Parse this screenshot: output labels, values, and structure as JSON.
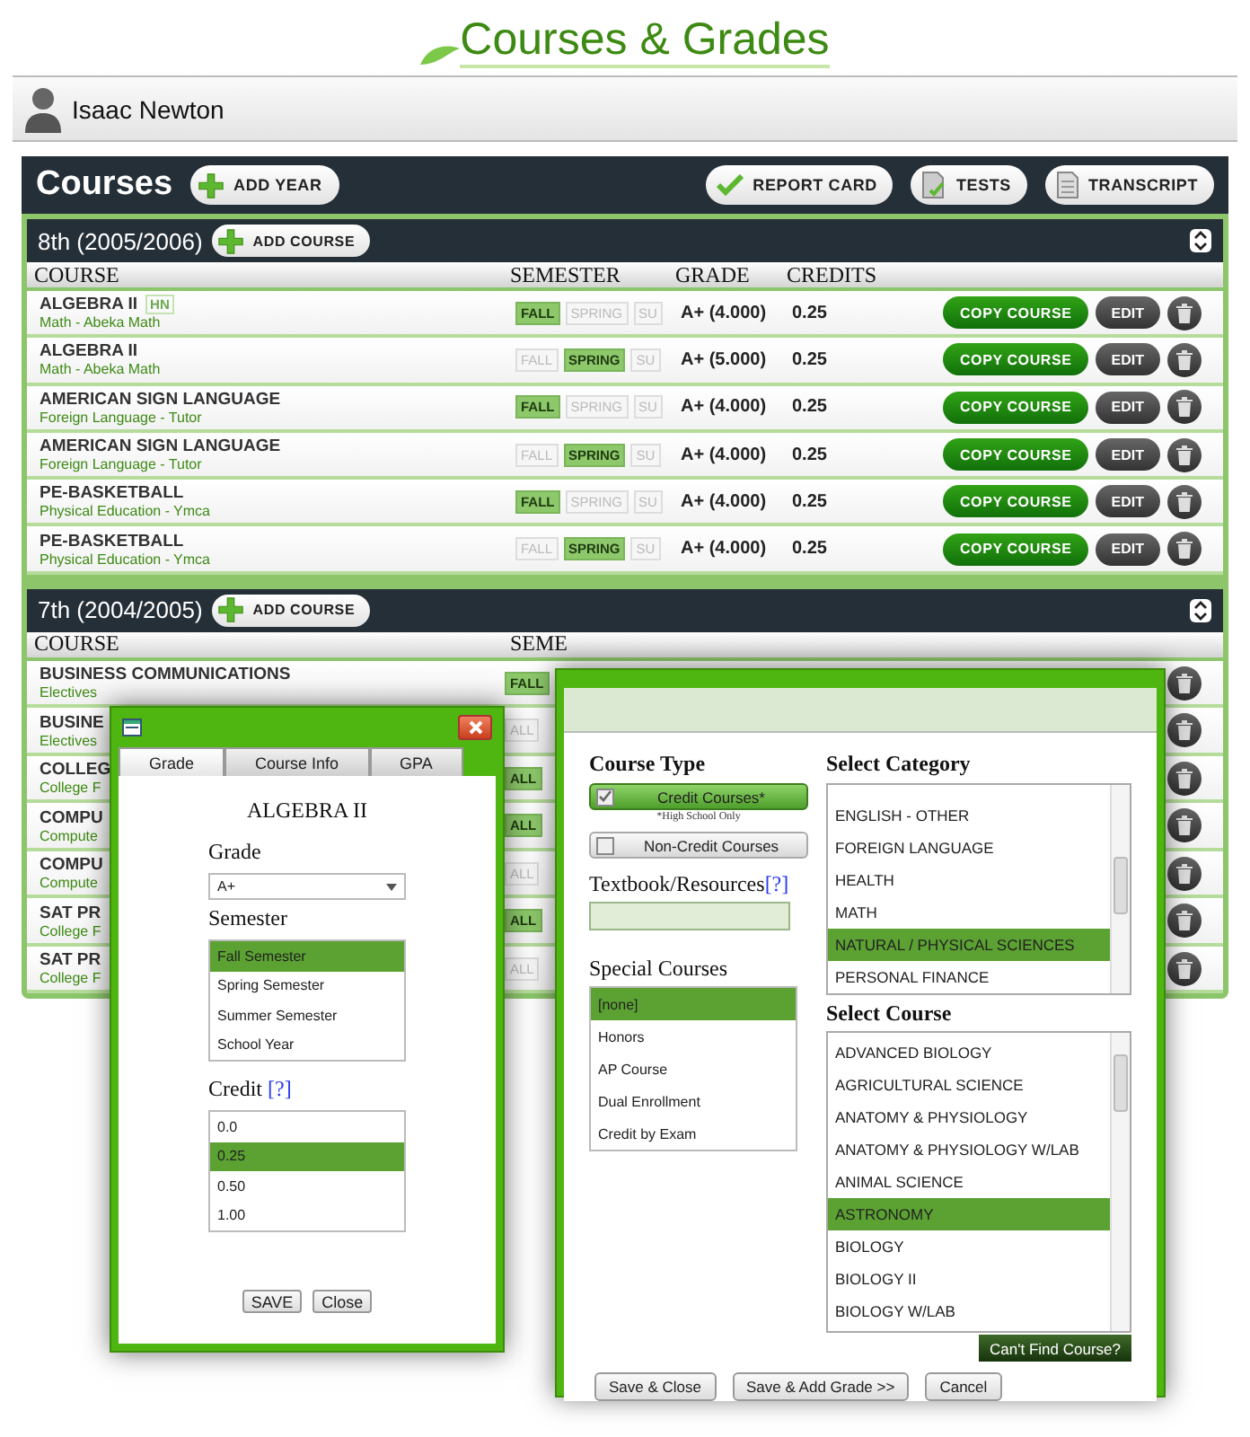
{
  "page_title": "Courses & Grades",
  "user": {
    "name": "Isaac Newton"
  },
  "courses_bar": {
    "title": "Courses",
    "add_button": "ADD YEAR",
    "actions": [
      {
        "label": "REPORT CARD",
        "kind": "check"
      },
      {
        "label": "TESTS",
        "kind": "tests"
      },
      {
        "label": "TRANSCRIPT",
        "kind": "doc"
      }
    ]
  },
  "year": {
    "title": "8th (2005/2006)",
    "add_button": "ADD COURSE",
    "columns": [
      "COURSE",
      "SEMESTER",
      "GRADE",
      "CREDITS"
    ],
    "rows": [
      {
        "name": "ALGEBRA II",
        "badge": "HN",
        "subtitle": "Math - Abeka Math",
        "semesters": [
          {
            "label": "FALL",
            "selected": true
          },
          {
            "label": "SPRING",
            "selected": false
          },
          {
            "label": "SU",
            "selected": false
          }
        ],
        "grade": "A+ (4.000)",
        "credits": "0.25",
        "copy_button": "COPY COURSE",
        "edit_button": "EDIT"
      },
      {
        "name": "ALGEBRA II",
        "subtitle": "Math - Abeka Math",
        "semesters": [
          {
            "label": "FALL",
            "selected": false
          },
          {
            "label": "SPRING",
            "selected": true
          },
          {
            "label": "SU",
            "selected": false
          }
        ],
        "grade": "A+ (5.000)",
        "credits": "0.25",
        "copy_button": "COPY COURSE",
        "edit_button": "EDIT"
      },
      {
        "name": "AMERICAN SIGN LANGUAGE",
        "subtitle": "Foreign Language - Tutor",
        "semesters": [
          {
            "label": "FALL",
            "selected": true
          },
          {
            "label": "SPRING",
            "selected": false
          },
          {
            "label": "SU",
            "selected": false
          }
        ],
        "grade": "A+ (4.000)",
        "credits": "0.25",
        "copy_button": "COPY COURSE",
        "edit_button": "EDIT"
      },
      {
        "name": "AMERICAN SIGN LANGUAGE",
        "subtitle": "Foreign Language - Tutor",
        "semesters": [
          {
            "label": "FALL",
            "selected": false
          },
          {
            "label": "SPRING",
            "selected": true
          },
          {
            "label": "SU",
            "selected": false
          }
        ],
        "grade": "A+ (4.000)",
        "credits": "0.25",
        "copy_button": "COPY COURSE",
        "edit_button": "EDIT"
      },
      {
        "name": "PE-BASKETBALL",
        "subtitle": "Physical Education - Ymca",
        "semesters": [
          {
            "label": "FALL",
            "selected": true
          },
          {
            "label": "SPRING",
            "selected": false
          },
          {
            "label": "SU",
            "selected": false
          }
        ],
        "grade": "A+ (4.000)",
        "credits": "0.25",
        "copy_button": "COPY COURSE",
        "edit_button": "EDIT"
      },
      {
        "name": "PE-BASKETBALL",
        "subtitle": "Physical Education - Ymca",
        "semesters": [
          {
            "label": "FALL",
            "selected": false
          },
          {
            "label": "SPRING",
            "selected": true
          },
          {
            "label": "SU",
            "selected": false
          }
        ],
        "grade": "A+ (4.000)",
        "credits": "0.25",
        "copy_button": "COPY COURSE",
        "edit_button": "EDIT"
      }
    ]
  },
  "covered_year": {
    "title": "7th (2004/2005)",
    "add_button": "ADD COURSE",
    "columns": [
      "COURSE",
      "SEME"
    ],
    "rows": [
      {
        "name": "BUSINESS COMMUNICATIONS",
        "subtitle": "Electives",
        "semester": "FALL",
        "selected": true
      },
      {
        "name": "BUSINE",
        "subtitle": "Electives",
        "semester": "ALL",
        "selected": false
      },
      {
        "name": "COLLEG",
        "subtitle": "College F",
        "semester": "ALL",
        "selected": true
      },
      {
        "name": "COMPU",
        "subtitle": "Compute",
        "semester": "ALL",
        "selected": true
      },
      {
        "name": "COMPU",
        "subtitle": "Compute",
        "semester": "ALL",
        "selected": false
      },
      {
        "name": "SAT PR",
        "subtitle": "College F",
        "semester": "ALL",
        "selected": true
      },
      {
        "name": "SAT PR",
        "subtitle": "College F",
        "semester": "ALL",
        "selected": false
      }
    ]
  },
  "grade_dialog": {
    "tabs": [
      {
        "label": "Grade",
        "selected": true
      },
      {
        "label": "Course Info",
        "selected": false
      },
      {
        "label": "GPA",
        "selected": false
      }
    ],
    "heading": "ALGEBRA II",
    "grade_label": "Grade",
    "grade_value": "A+",
    "semester_label": "Semester",
    "semesters": [
      {
        "label": "Fall Semester",
        "selected": true
      },
      {
        "label": "Spring Semester",
        "selected": false
      },
      {
        "label": "Summer Semester",
        "selected": false
      },
      {
        "label": "School Year",
        "selected": false
      }
    ],
    "credit_label": "Credit",
    "credit_help": "[?]",
    "credits": [
      {
        "label": "0.0",
        "selected": false
      },
      {
        "label": "0.25",
        "selected": true
      },
      {
        "label": "0.50",
        "selected": false
      },
      {
        "label": "1.00",
        "selected": false
      }
    ],
    "buttons": [
      "SAVE",
      "Close"
    ]
  },
  "course_dialog": {
    "course_type_label": "Course Type",
    "course_types": [
      {
        "label": "Credit Courses*",
        "checked": true,
        "note": "*High School Only"
      },
      {
        "label": "Non-Credit Courses",
        "checked": false
      }
    ],
    "textbook_label": "Textbook/Resources",
    "textbook_help": "[?]",
    "special_label": "Special Courses",
    "special_courses": [
      {
        "label": "[none]",
        "selected": true
      },
      {
        "label": "Honors",
        "selected": false
      },
      {
        "label": "AP Course",
        "selected": false
      },
      {
        "label": "Dual Enrollment",
        "selected": false
      },
      {
        "label": "Credit by Exam",
        "selected": false
      }
    ],
    "category_label": "Select Category",
    "categories": [
      {
        "label": "ENGLISH - OTHER",
        "selected": false
      },
      {
        "label": "FOREIGN LANGUAGE",
        "selected": false
      },
      {
        "label": "HEALTH",
        "selected": false
      },
      {
        "label": "MATH",
        "selected": false
      },
      {
        "label": "NATURAL / PHYSICAL SCIENCES",
        "selected": true
      },
      {
        "label": "PERSONAL FINANCE",
        "selected": false
      }
    ],
    "course_label": "Select Course",
    "courses": [
      {
        "label": "ADVANCED BIOLOGY",
        "selected": false
      },
      {
        "label": "AGRICULTURAL SCIENCE",
        "selected": false
      },
      {
        "label": "ANATOMY & PHYSIOLOGY",
        "selected": false
      },
      {
        "label": "ANATOMY & PHYSIOLOGY W/LAB",
        "selected": false
      },
      {
        "label": "ANIMAL SCIENCE",
        "selected": false
      },
      {
        "label": "ASTRONOMY",
        "selected": true
      },
      {
        "label": "BIOLOGY",
        "selected": false
      },
      {
        "label": "BIOLOGY II",
        "selected": false
      },
      {
        "label": "BIOLOGY W/LAB",
        "selected": false
      }
    ],
    "cant_find_button": "Can't Find Course?",
    "buttons": [
      "Save & Close",
      "Save & Add Grade >>",
      "Cancel"
    ]
  }
}
